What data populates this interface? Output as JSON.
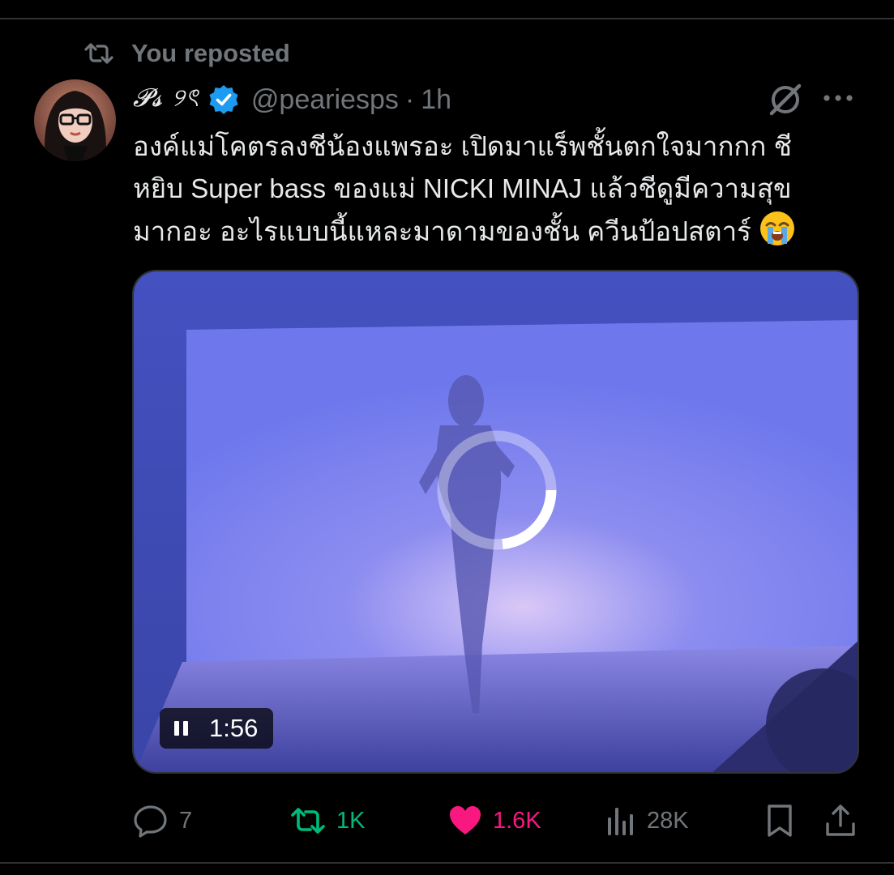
{
  "context": {
    "repost_label": "You reposted"
  },
  "tweet": {
    "display_name": "𝓟𝓼 ୨ৎ",
    "handle": "@peariesps",
    "separator": "·",
    "time": "1h",
    "text_lines": [
      "องค์แม่โคตรลงชีน้องแพรอะ เปิดมาแร็พชั้นตกใจมากกก ชี",
      "หยิบ Super bass ของแม่ NICKI MINAJ แล้วชีดูมีความสุข",
      "มากอะ อะไรแบบนี้แหละมาดามของชั้น ควีนป้อปสตาร์"
    ],
    "text_emoji": "loudly-crying-face-emoji"
  },
  "media": {
    "type": "video",
    "duration": "1:56",
    "state_icon": "pause-icon",
    "loading_progress": 0.3
  },
  "actions": {
    "replies": "7",
    "reposts": "1K",
    "likes": "1.6K",
    "views": "28K"
  },
  "colors": {
    "background": "#000000",
    "text": "#e7e9ea",
    "muted": "#71767b",
    "repost_green": "#00ba7c",
    "like_pink": "#f91880",
    "verified_blue": "#1d9bf0",
    "divider": "#2f3336"
  },
  "icons": {
    "repost_context": "repost-icon",
    "verified": "verified-badge-icon",
    "grok": "grok-icon",
    "more": "more-icon",
    "reply": "reply-icon",
    "repost": "repost-icon",
    "like": "heart-icon",
    "views": "views-chart-icon",
    "bookmark": "bookmark-icon",
    "share": "share-icon"
  }
}
